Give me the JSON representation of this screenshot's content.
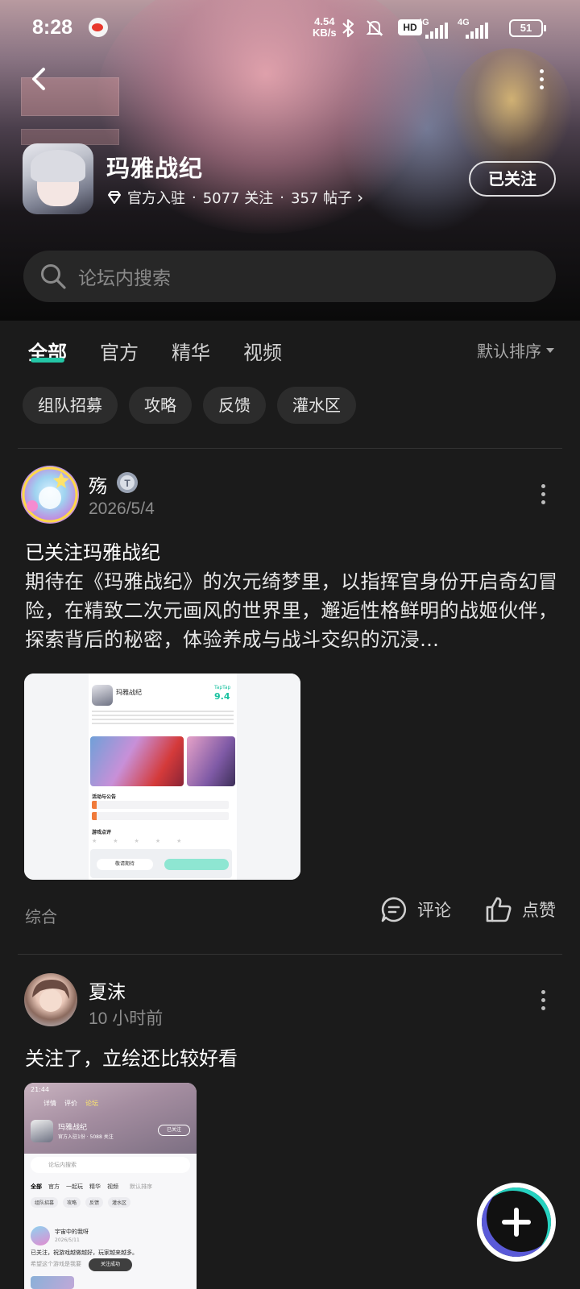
{
  "status_bar": {
    "time": "8:28",
    "net_speed_value": "4.54",
    "net_speed_unit": "KB/s",
    "hd_badge": "HD",
    "signal1_label": "4G",
    "signal2_label": "4G",
    "battery": "51"
  },
  "header": {
    "game_name": "玛雅战纪",
    "official": "官方入驻",
    "separator": "·",
    "followers": "5077 关注",
    "posts": "357 帖子",
    "follow_button": "已关注",
    "search_placeholder": "论坛内搜索"
  },
  "tabs": {
    "items": [
      {
        "label": "全部",
        "active": true
      },
      {
        "label": "官方",
        "active": false
      },
      {
        "label": "精华",
        "active": false
      },
      {
        "label": "视频",
        "active": false
      }
    ],
    "sort_label": "默认排序"
  },
  "chips": [
    "组队招募",
    "攻略",
    "反馈",
    "灌水区"
  ],
  "posts": [
    {
      "user": "殇",
      "date": "2026/5/4",
      "title": "已关注玛雅战纪",
      "body": "期待在《玛雅战纪》的次元绮梦里，以指挥官身份开启奇幻冒险，在精致二次元画风的世界里，邂逅性格鲜明的战姬伙伴，探索背后的秘密，体验养成与战斗交织的沉浸…",
      "tag": "综合",
      "comment_label": "评论",
      "like_label": "点赞",
      "thumb": {
        "game_name": "玛雅战纪",
        "rating_label": "TapTap",
        "rating": "9.4",
        "section1": "活动与公告",
        "section2": "游戏点评",
        "button1": "敬请期待"
      }
    },
    {
      "user": "夏沫",
      "date": "10 小时前",
      "title": "关注了，立绘还比较好看",
      "thumb": {
        "time": "21:44",
        "tabs": [
          "详情",
          "评价",
          "论坛"
        ],
        "game_name": "玛雅战纪",
        "meta": "官方入驻1份 · 5088 关注",
        "follow": "已关注",
        "search": "论坛内搜索",
        "tab_row": [
          "全部",
          "官方",
          "一起玩",
          "精华",
          "视频"
        ],
        "sort": "默认排序",
        "chips": [
          "组队招募",
          "攻略",
          "反馈",
          "灌水区"
        ],
        "user": "宇宙中的我呀",
        "date": "2026/5/11",
        "text1": "已关注，祝游戏越做越好，玩家越来越多。",
        "text2": "希望这个游戏是我要",
        "toast": "关注成功"
      }
    }
  ]
}
